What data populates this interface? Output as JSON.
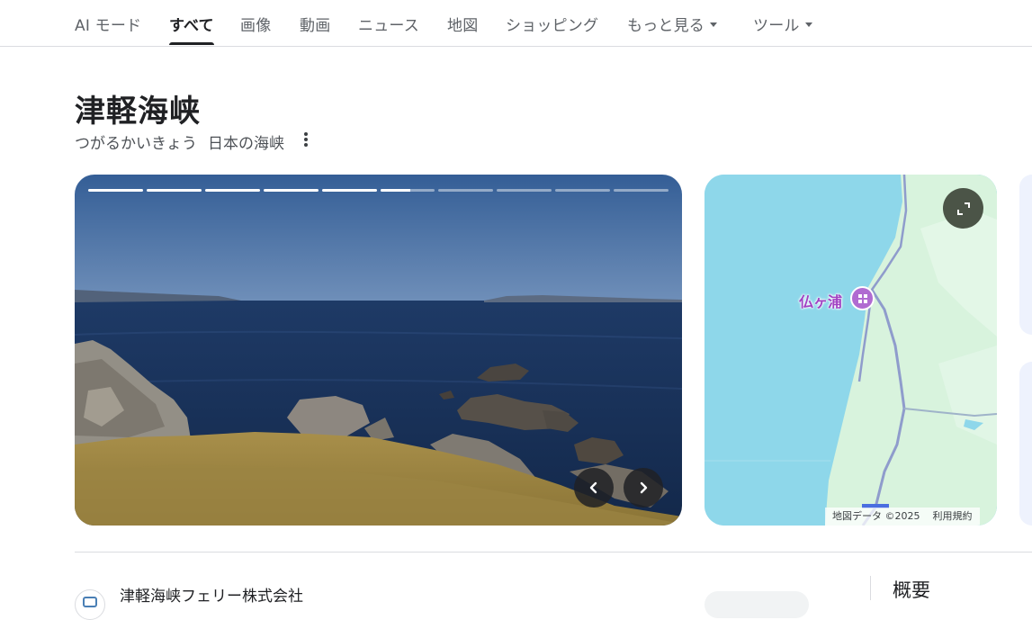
{
  "nav": {
    "tabs": [
      {
        "label": "AI モード",
        "active": false
      },
      {
        "label": "すべて",
        "active": true
      },
      {
        "label": "画像",
        "active": false
      },
      {
        "label": "動画",
        "active": false
      },
      {
        "label": "ニュース",
        "active": false
      },
      {
        "label": "地図",
        "active": false
      },
      {
        "label": "ショッピング",
        "active": false
      },
      {
        "label": "もっと見る",
        "active": false,
        "dropdown": true
      },
      {
        "label": "ツール",
        "active": false,
        "dropdown": true
      }
    ]
  },
  "entity": {
    "title": "津軽海峡",
    "reading": "つがるかいきょう",
    "description": "日本の海峡"
  },
  "carousel": {
    "segments": 10,
    "current_segment": 6,
    "current_segment_progress": 0.55,
    "prev_icon": "chevron-left-icon",
    "next_icon": "chevron-right-icon"
  },
  "map": {
    "place_label": "仏ヶ浦",
    "attribution": "地図データ ©2025",
    "terms": "利用規約",
    "expand_icon": "expand-icon",
    "water_color": "#8ed7ea",
    "land_color": "#d8f3dd"
  },
  "result": {
    "title": "津軽海峡フェリー株式会社"
  },
  "panel": {
    "heading": "概要"
  }
}
